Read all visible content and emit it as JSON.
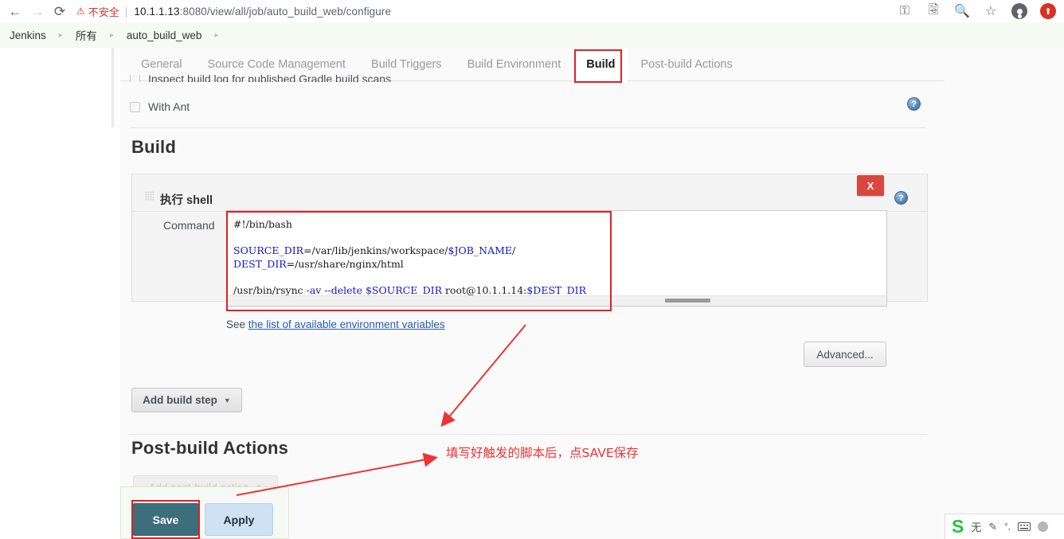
{
  "browser": {
    "back_icon": "arrow-left-icon",
    "forward_icon": "arrow-right-icon",
    "reload_icon": "reload-icon",
    "security_warning": "不安全",
    "url_host": "10.1.1.13",
    "url_rest": ":8080/view/all/job/auto_build_web/configure",
    "toolbar_icons": [
      "key-icon",
      "translate-icon",
      "zoom-icon",
      "bookmark-star-icon",
      "profile-avatar-icon",
      "update-icon"
    ]
  },
  "breadcrumb": {
    "items": [
      "Jenkins",
      "所有",
      "auto_build_web"
    ],
    "separator": "▸",
    "trailing_separator": "▸"
  },
  "tabs": [
    {
      "label": "General",
      "active": false
    },
    {
      "label": "Source Code Management",
      "active": false
    },
    {
      "label": "Build Triggers",
      "active": false
    },
    {
      "label": "Build Environment",
      "active": false
    },
    {
      "label": "Build",
      "active": true
    },
    {
      "label": "Post-build Actions",
      "active": false
    }
  ],
  "build_environment": {
    "clipped_option": "Inspect build log for published Gradle build scans",
    "with_ant_label": "With Ant",
    "help_icon": "help-icon"
  },
  "build_section": {
    "title": "Build",
    "step": {
      "grip_icon": "drag-grip-icon",
      "title": "执行 shell",
      "delete_label": "X",
      "help_icon": "help-icon",
      "command_label": "Command",
      "command_lines": [
        {
          "plain": "#!/bin/bash"
        },
        {
          "plain": ""
        },
        {
          "segments": [
            {
              "t": "SOURCE_DIR",
              "c": "var"
            },
            {
              "t": "=/var/lib/jenkins/workspace/",
              "c": "plain"
            },
            {
              "t": "$JOB_NAME",
              "c": "var"
            },
            {
              "t": "/",
              "c": "plain"
            }
          ]
        },
        {
          "segments": [
            {
              "t": "DEST_DIR",
              "c": "var"
            },
            {
              "t": "=/usr/share/nginx/html",
              "c": "plain"
            }
          ]
        },
        {
          "plain": ""
        },
        {
          "segments": [
            {
              "t": "/usr/bin/rsync ",
              "c": "plain"
            },
            {
              "t": "-av --delete",
              "c": "var"
            },
            {
              "t": " ",
              "c": "plain"
            },
            {
              "t": "$SOURCE_DIR",
              "c": "var"
            },
            {
              "t": " root@10.1.1.14:",
              "c": "plain"
            },
            {
              "t": "$DEST_DIR",
              "c": "var"
            }
          ]
        }
      ],
      "env_prefix": "See ",
      "env_link": "the list of available environment variables",
      "advanced_label": "Advanced..."
    },
    "add_build_step_label": "Add build step",
    "caret": "▼"
  },
  "post_build": {
    "title": "Post-build Actions",
    "add_action_label": "Add post-build action",
    "caret": "▼"
  },
  "actions": {
    "save_label": "Save",
    "apply_label": "Apply"
  },
  "annotations": {
    "note_text": "填写好触发的脚本后，点SAVE保存",
    "color": "#ef3333"
  },
  "ime": {
    "logo": "S",
    "mode_label": "无",
    "icons": [
      "pen-icon",
      "punctuation-icon",
      "keyboard-icon",
      "person-icon"
    ]
  }
}
